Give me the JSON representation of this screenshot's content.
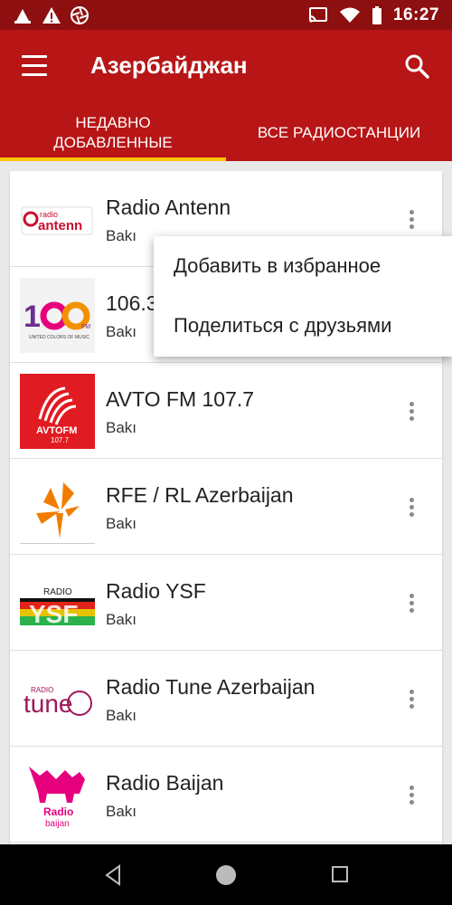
{
  "status_bar": {
    "time": "16:27",
    "left_icons": [
      "android-icon",
      "warning-icon",
      "aperture-icon"
    ],
    "right_icons": [
      "cast-icon",
      "wifi-icon",
      "battery-icon"
    ]
  },
  "app_bar": {
    "title": "Азербайджан",
    "background": "#b71516"
  },
  "tabs": [
    {
      "label": "Недавно добавленные",
      "active": true
    },
    {
      "label": "Все радиостанции",
      "active": false
    }
  ],
  "accent": "#ffc400",
  "stations": [
    {
      "name": "Radio Antenn",
      "city": "Bakı",
      "logo_text": "radio antenn"
    },
    {
      "name": "106.3",
      "city": "Bakı",
      "logo_text": "106 FM",
      "logo_sub": "UNITED COLORS OF MUSIC"
    },
    {
      "name": "AVTO FM 107.7",
      "city": "Bakı",
      "logo_text": "AVTOFM",
      "logo_sub": "107.7"
    },
    {
      "name": "RFE / RL Azerbaijan",
      "city": "Bakı"
    },
    {
      "name": "Radio YSF",
      "city": "Bakı",
      "logo_text": "YSF",
      "logo_sub": "RADIO"
    },
    {
      "name": "Radio Tune Azerbaijan",
      "city": "Bakı",
      "logo_text": "tune",
      "logo_sub": "RADIO"
    },
    {
      "name": "Radio Baijan",
      "city": "Bakı",
      "logo_text": "Radio",
      "logo_sub": "baijan"
    }
  ],
  "popup_menu": {
    "items": [
      "Добавить в избранное",
      "Поделиться с друзьями"
    ]
  }
}
